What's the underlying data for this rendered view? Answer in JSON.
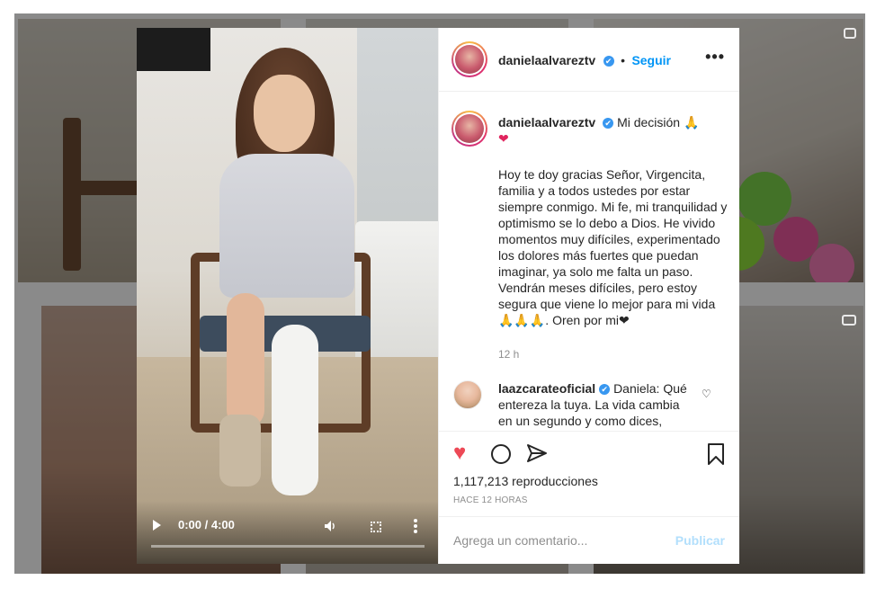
{
  "post": {
    "username": "danielaalvareztv",
    "separator": "•",
    "follow_label": "Seguir",
    "more_label": "•••",
    "caption_title": "Mi decisión 🙏",
    "caption_heart": "❤",
    "caption_body": "Hoy te doy gracias Señor, Virgencita, familia y a todos ustedes por estar siempre conmigo. Mi fe, mi tranquilidad y optimismo se lo debo a Dios. He vivido momentos muy difíciles, experimentado los dolores más fuertes que puedan imaginar, ya solo me falta un paso. Vendrán meses difíciles, pero estoy segura que viene lo mejor para mi vida 🙏🙏🙏. Oren por mi❤",
    "caption_time": "12 h",
    "verified_mark": "✔"
  },
  "comment": {
    "username": "laazcarateoficial",
    "text": "Daniela: Qué entereza la tuya. La vida cambia en un segundo y como dices,",
    "heart": "♡"
  },
  "actions": {
    "like_icon": "♥",
    "views": "1,117,213 reproducciones",
    "ago": "HACE 12 HORAS",
    "comment_placeholder": "Agrega un comentario...",
    "publish_label": "Publicar"
  },
  "video": {
    "time": "0:00 / 4:00",
    "progress_fraction": 0.0
  },
  "colors": {
    "accent": "#0095f6",
    "like": "#ed4956",
    "publish_disabled": "#b2dffc"
  }
}
